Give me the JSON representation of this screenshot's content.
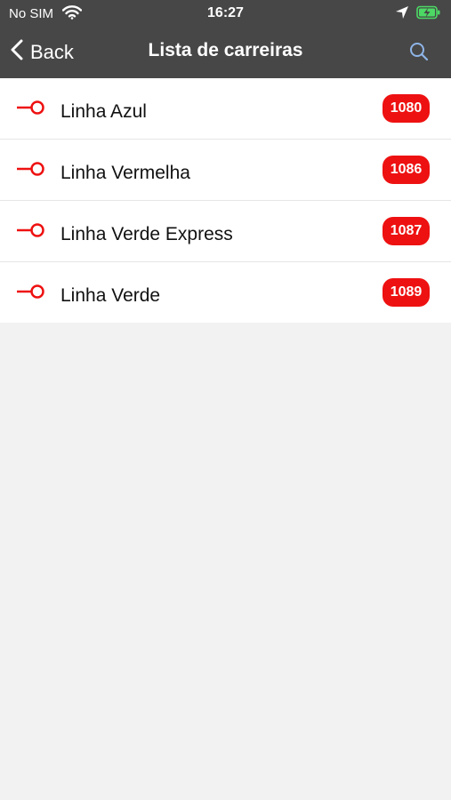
{
  "status_bar": {
    "carrier": "No SIM",
    "time": "16:27",
    "icons": [
      "wifi-icon",
      "location-arrow-icon",
      "battery-charging-icon"
    ]
  },
  "nav": {
    "back_label": "Back",
    "title": "Lista de carreiras",
    "back_icon": "chevron-left-icon",
    "search_icon": "search-icon"
  },
  "colors": {
    "header_bg": "#474747",
    "accent_red": "#ee1111",
    "page_bg": "#f2f2f2",
    "battery_green": "#4cd964",
    "search_blue": "#8fb5e8"
  },
  "routes": [
    {
      "name": "Linha Azul",
      "number": "1080",
      "icon": "route-line-icon"
    },
    {
      "name": "Linha Vermelha",
      "number": "1086",
      "icon": "route-line-icon"
    },
    {
      "name": "Linha Verde Express",
      "number": "1087",
      "icon": "route-line-icon"
    },
    {
      "name": "Linha Verde",
      "number": "1089",
      "icon": "route-line-icon"
    }
  ]
}
